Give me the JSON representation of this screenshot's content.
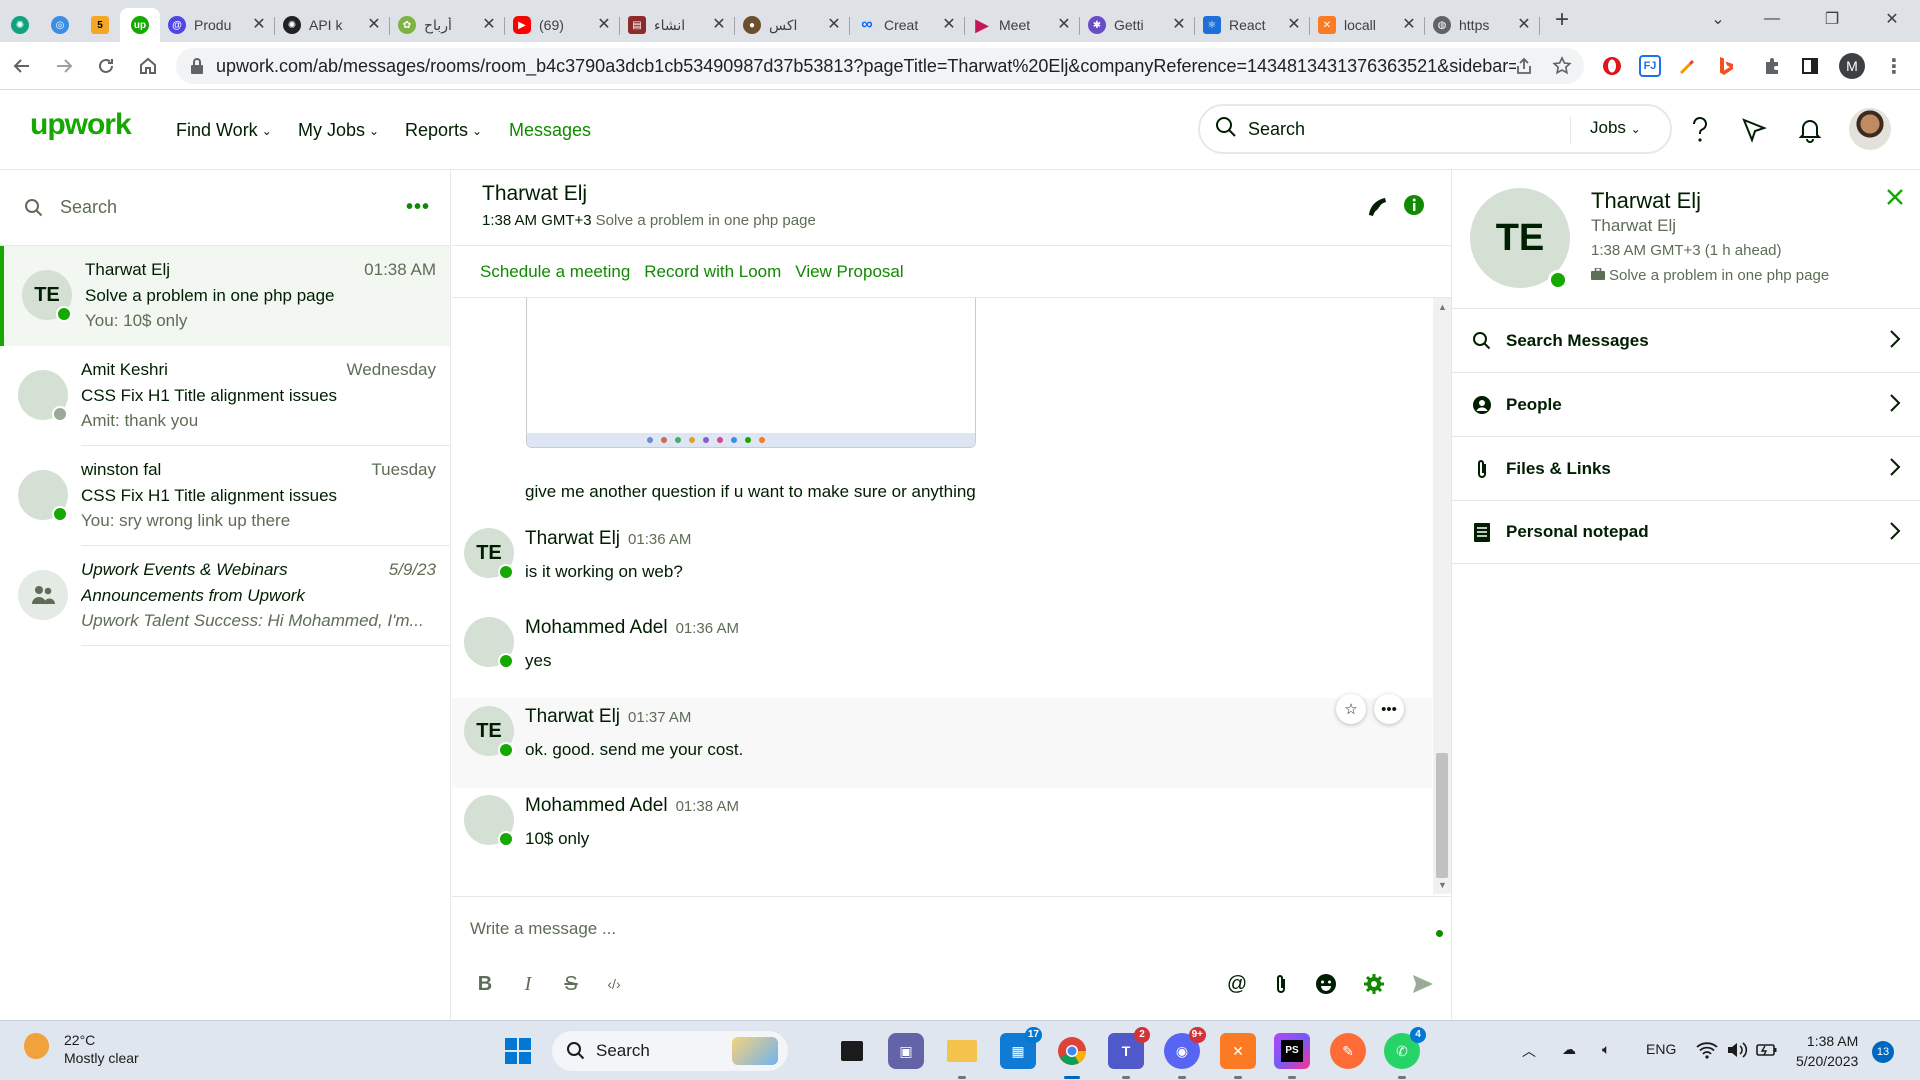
{
  "browser": {
    "tabs": [
      {
        "title": "",
        "icon": "chatgpt-icon",
        "color": "#10a37f",
        "pinned": true
      },
      {
        "title": "",
        "icon": "circle-app-icon",
        "color": "#3a8ee6",
        "pinned": true
      },
      {
        "title": "",
        "icon": "five-icon",
        "color": "#f5a623",
        "pinned": true,
        "glyph": "5"
      },
      {
        "title": "",
        "icon": "upwork-icon",
        "color": "#14a800",
        "pinned": true,
        "glyph": "up",
        "active": true
      },
      {
        "title": "Produ",
        "icon": "spiral-icon",
        "color": "#4f46e5"
      },
      {
        "title": "API k",
        "icon": "openai-icon",
        "color": "#202123"
      },
      {
        "title": "أرباح",
        "icon": "leaf-icon",
        "color": "#7cb342"
      },
      {
        "title": "(69)",
        "icon": "youtube-icon",
        "color": "#ff0000"
      },
      {
        "title": "انشاء",
        "icon": "doc-icon",
        "color": "#8d2b2b"
      },
      {
        "title": "اكس",
        "icon": "person-icon",
        "color": "#6b4e2e"
      },
      {
        "title": "Creat",
        "icon": "meta-icon",
        "color": "#0866ff"
      },
      {
        "title": "Meet",
        "icon": "play-icon",
        "color": "#c2185b"
      },
      {
        "title": "Getti",
        "icon": "gear-circle-icon",
        "color": "#6a4cc7"
      },
      {
        "title": "React",
        "icon": "react-doc-icon",
        "color": "#1e6fd9"
      },
      {
        "title": "locall",
        "icon": "xampp-icon",
        "color": "#fb7a24"
      },
      {
        "title": "https",
        "icon": "globe-icon",
        "color": "#5f6368"
      }
    ],
    "url": "upwork.com/ab/messages/rooms/room_b4c3790a3dcb1cb53490987d37b53813?pageTitle=Tharwat%20Elj&companyReference=1434813431376363521&sidebar=tr...",
    "profile_initial": "M"
  },
  "upwork": {
    "logo": "upwork",
    "nav": {
      "find_work": "Find Work",
      "my_jobs": "My Jobs",
      "reports": "Reports",
      "messages": "Messages"
    },
    "search": {
      "placeholder": "Search",
      "scope": "Jobs"
    }
  },
  "rooms": {
    "search_placeholder": "Search",
    "items": [
      {
        "name": "Tharwat Elj",
        "time": "01:38 AM",
        "topic": "Solve a problem in one php page",
        "last": "You: 10$ only",
        "initials": "TE",
        "online": true,
        "active": true
      },
      {
        "name": "Amit Keshri",
        "time": "Wednesday",
        "topic": "CSS Fix H1 Title alignment issues",
        "last": "Amit: thank you",
        "initials": "",
        "online": false
      },
      {
        "name": "winston fal",
        "time": "Tuesday",
        "topic": "CSS Fix H1 Title alignment issues",
        "last": "You: sry wrong link up there",
        "initials": "",
        "online": true
      },
      {
        "name": "Upwork Events & Webinars",
        "time": "5/9/23",
        "topic": "Announcements from Upwork",
        "last": "Upwork Talent Success: Hi Mohammed, I'm...",
        "initials": "",
        "online": false
      }
    ]
  },
  "chat": {
    "title": "Tharwat Elj",
    "local_time": "1:38 AM GMT+3",
    "project": "Solve a problem in one php page",
    "actions": [
      "Schedule a meeting",
      "Record with Loom",
      "View Proposal"
    ],
    "prior_text": "give me another question if u want to make sure or anything",
    "messages": [
      {
        "sender": "Tharwat Elj",
        "time": "01:36 AM",
        "text": "is it working on web?",
        "initials": "TE"
      },
      {
        "sender": "Mohammed Adel",
        "time": "01:36 AM",
        "text": "yes",
        "initials": ""
      },
      {
        "sender": "Tharwat Elj",
        "time": "01:37 AM",
        "text": "ok. good. send me your cost.",
        "initials": "TE"
      },
      {
        "sender": "Mohammed Adel",
        "time": "01:38 AM",
        "text": "10$ only",
        "initials": ""
      }
    ],
    "composer_placeholder": "Write a message ..."
  },
  "details": {
    "initials": "TE",
    "name": "Tharwat Elj",
    "sub": "Tharwat Elj",
    "time": "1:38 AM GMT+3 (1 h ahead)",
    "project": "Solve a problem in one php page",
    "rows": [
      "Search Messages",
      "People",
      "Files & Links",
      "Personal notepad"
    ]
  },
  "taskbar": {
    "weather_temp": "22°C",
    "weather_desc": "Mostly clear",
    "search_label": "Search",
    "badges": {
      "news": "17",
      "teams": "2",
      "discord": "9+",
      "whatsapp": "4"
    },
    "lang": "ENG",
    "time": "1:38 AM",
    "date": "5/20/2023",
    "notifications": "13"
  },
  "colors": {
    "brand": "#14a800",
    "link": "#108a00",
    "online": "#14a800"
  }
}
